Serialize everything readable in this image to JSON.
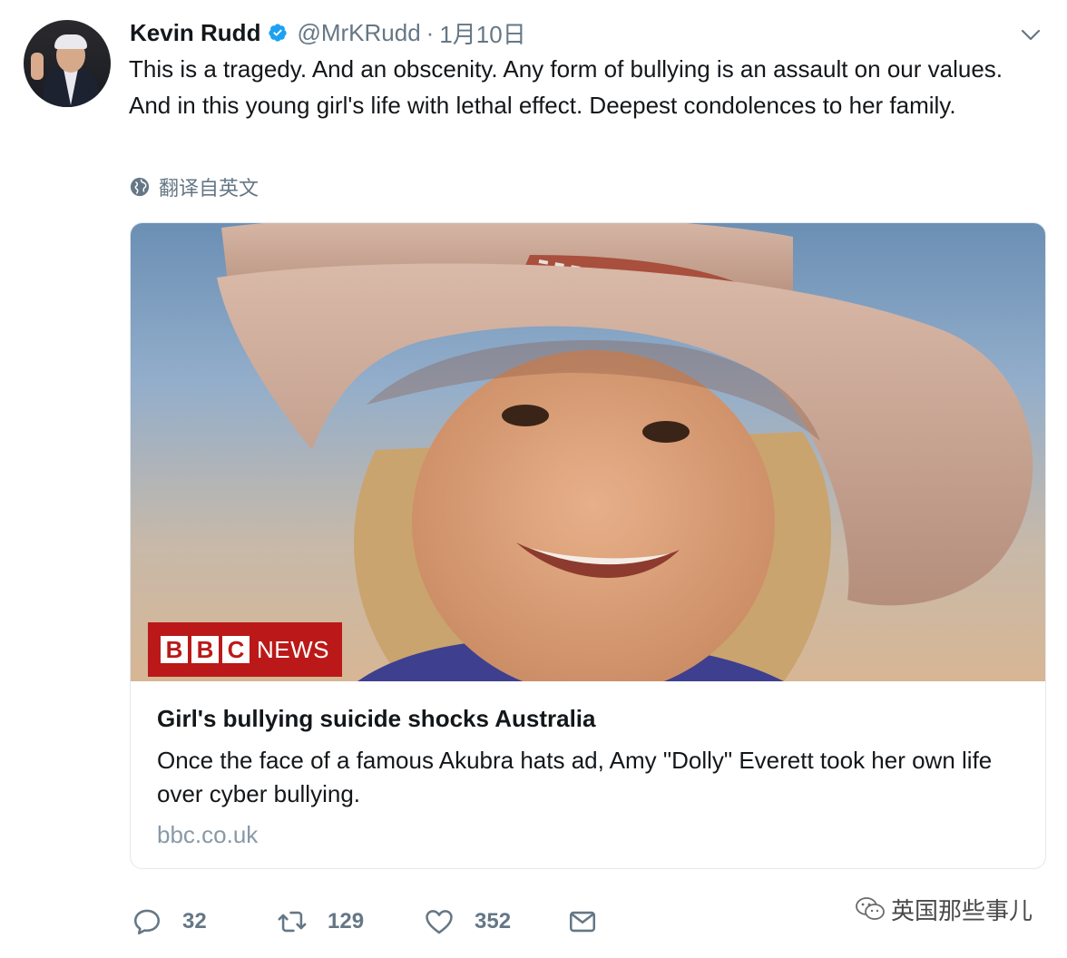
{
  "author": {
    "name": "Kevin Rudd",
    "handle": "@MrKRudd",
    "separator": "·",
    "date": "1月10日",
    "verified": true,
    "avatar_icon": "avatar"
  },
  "tweet": {
    "text": "This is a tragedy. And an obscenity. Any form of bullying is an assault on our values. And in this young girl's life with lethal effect. Deepest condolences to her family.",
    "translate_label": "翻译自英文"
  },
  "card": {
    "image_badge": {
      "letters": [
        "B",
        "B",
        "C"
      ],
      "word": "NEWS"
    },
    "title": "Girl's bullying suicide shocks Australia",
    "description": "Once the face of a famous Akubra hats ad, Amy \"Dolly\" Everett took her own life over cyber bullying.",
    "domain": "bbc.co.uk"
  },
  "actions": {
    "replies": "32",
    "retweets": "129",
    "likes": "352"
  },
  "watermark": {
    "text": "英国那些事儿"
  },
  "colors": {
    "verified": "#1da1f2",
    "secondary_text": "#657786",
    "bbc_red": "#bb1919",
    "card_border": "#e1e8ed"
  }
}
